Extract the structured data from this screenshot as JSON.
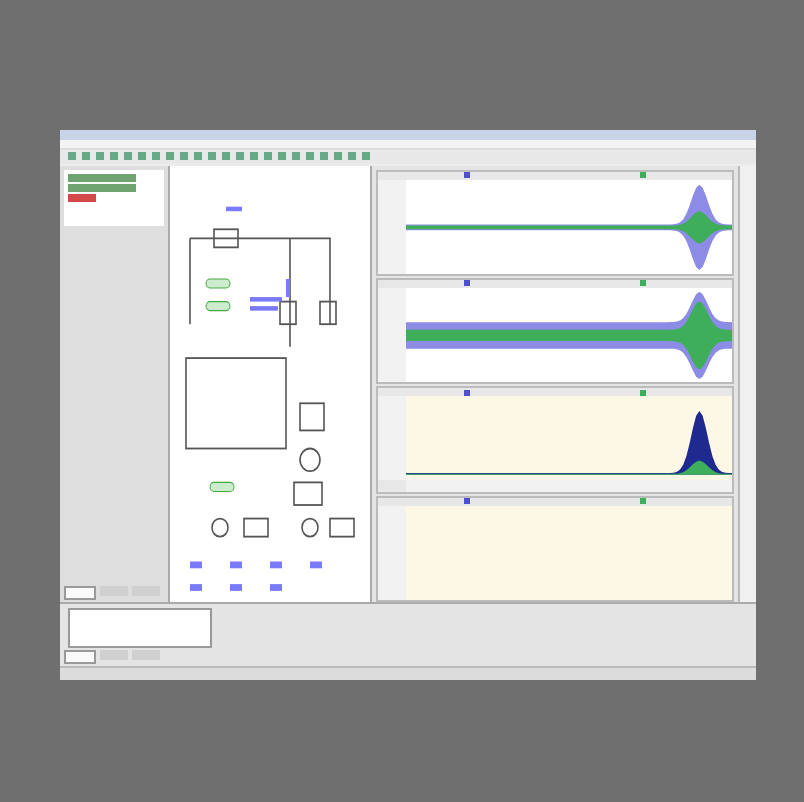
{
  "tree_items": [
    {
      "selected": false
    },
    {
      "selected": false
    },
    {
      "selected": true
    }
  ],
  "side_tabs": [
    {
      "selected": true
    },
    {
      "selected": false
    },
    {
      "selected": false
    }
  ],
  "graphs": [
    {
      "kind": "burst",
      "shaded": false
    },
    {
      "kind": "wide",
      "shaded": false
    },
    {
      "kind": "peak",
      "shaded": true
    },
    {
      "kind": "empty",
      "shaded": true
    }
  ],
  "bottom_tabs": [
    {
      "selected": true
    },
    {
      "selected": false
    },
    {
      "selected": false
    }
  ]
}
